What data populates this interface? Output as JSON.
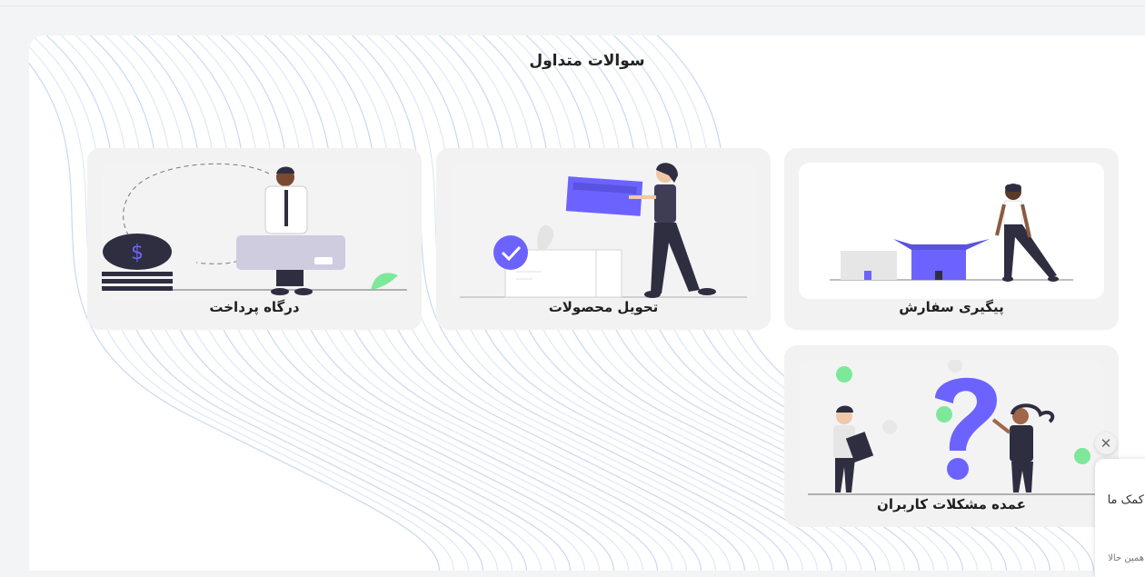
{
  "page": {
    "title": "سوالات متداول"
  },
  "cards": [
    {
      "label": "پیگیری سفارش"
    },
    {
      "label": "تحویل محصولات"
    },
    {
      "label": "درگاه پرداخت"
    },
    {
      "label": "عمده مشکلات کاربران"
    }
  ],
  "chat_widget": {
    "close_symbol": "✕",
    "title": "کمک ما",
    "subtitle": "همین حالا"
  },
  "colors": {
    "accent": "#6c63ff",
    "dark": "#2f2e41",
    "green": "#7ee89a"
  }
}
